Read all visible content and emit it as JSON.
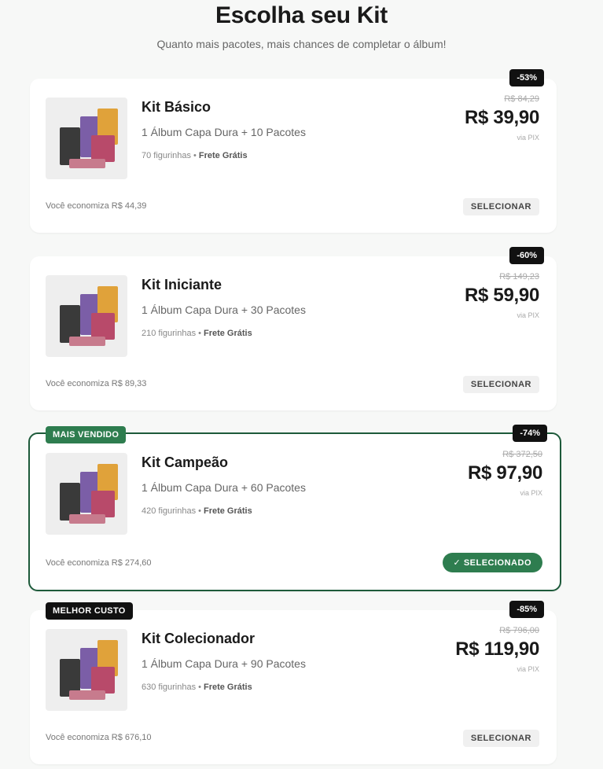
{
  "header": {
    "title": "Escolha seu Kit",
    "subtitle": "Quanto mais pacotes, mais chances de completar o álbum!"
  },
  "kits": [
    {
      "name": "Kit Básico",
      "description": "1 Álbum Capa Dura + 10 Pacotes",
      "stickers": "70 figurinhas",
      "shipping": "Frete Grátis",
      "discount": "-53%",
      "old_price": "R$ 84,29",
      "price": "R$ 39,90",
      "payment": "via PIX",
      "savings": "Você economiza R$ 44,39",
      "button": "SELECIONAR",
      "selected": false,
      "ribbon": ""
    },
    {
      "name": "Kit Iniciante",
      "description": "1 Álbum Capa Dura + 30 Pacotes",
      "stickers": "210 figurinhas",
      "shipping": "Frete Grátis",
      "discount": "-60%",
      "old_price": "R$ 149,23",
      "price": "R$ 59,90",
      "payment": "via PIX",
      "savings": "Você economiza R$ 89,33",
      "button": "SELECIONAR",
      "selected": false,
      "ribbon": ""
    },
    {
      "name": "Kit Campeão",
      "description": "1 Álbum Capa Dura + 60 Pacotes",
      "stickers": "420 figurinhas",
      "shipping": "Frete Grátis",
      "discount": "-74%",
      "old_price": "R$ 372,50",
      "price": "R$ 97,90",
      "payment": "via PIX",
      "savings": "Você economiza R$ 274,60",
      "button": "✓ SELECIONADO",
      "selected": true,
      "ribbon": "MAIS VENDIDO"
    },
    {
      "name": "Kit Colecionador",
      "description": "1 Álbum Capa Dura + 90 Pacotes",
      "stickers": "630 figurinhas",
      "shipping": "Frete Grátis",
      "discount": "-85%",
      "old_price": "R$ 796,00",
      "price": "R$ 119,90",
      "payment": "via PIX",
      "savings": "Você economiza R$ 676,10",
      "button": "SELECIONAR",
      "selected": false,
      "ribbon": "MELHOR CUSTO"
    }
  ],
  "colors": {
    "accent_green": "#2e7d4f",
    "selected_border": "#1d5a3a",
    "badge_black": "#111111"
  }
}
